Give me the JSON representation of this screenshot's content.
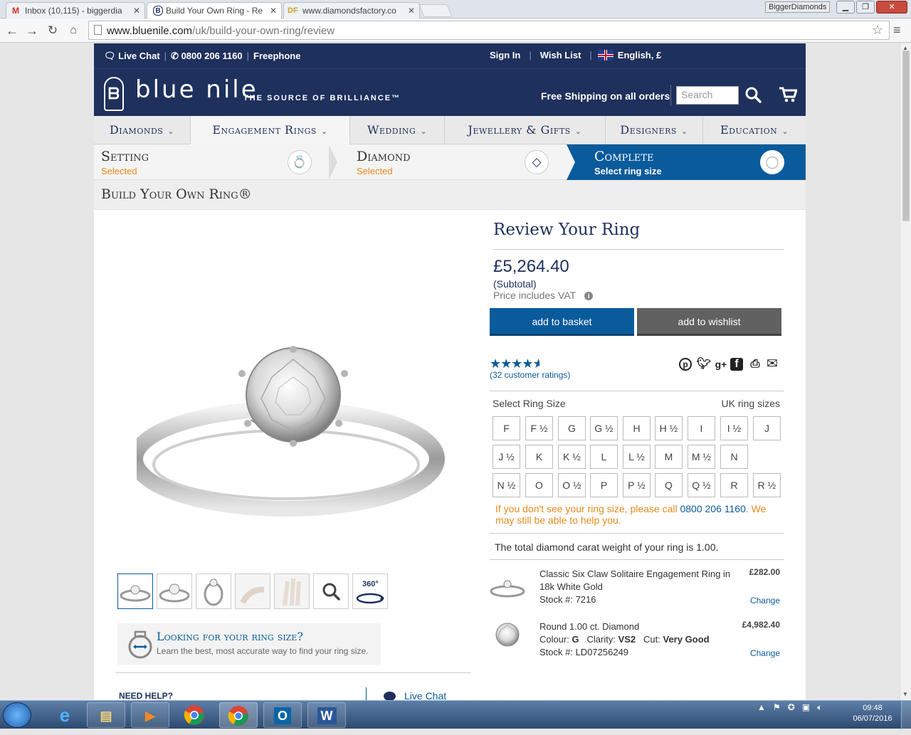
{
  "browser": {
    "tabs": [
      {
        "icon": "M",
        "title": "Inbox (10,115) - biggerdia"
      },
      {
        "icon": "B",
        "title": "Build Your Own Ring - Re"
      },
      {
        "icon": "DF",
        "title": "www.diamondsfactory.co"
      }
    ],
    "user_badge": "BiggerDiamonds",
    "url_host": "www.bluenile.com",
    "url_path": "/uk/build-your-own-ring/review"
  },
  "util": {
    "live_chat": "Live Chat",
    "phone": "0800 206 1160",
    "freephone": "Freephone",
    "sign_in": "Sign In",
    "wish_list": "Wish List",
    "locale": "English, £"
  },
  "header": {
    "logo_text": "blue nile",
    "tagline": "THE SOURCE OF BRILLIANCE™",
    "free_shipping": "Free Shipping on all orders",
    "search_placeholder": "Search"
  },
  "nav": [
    "Diamonds",
    "Engagement Rings",
    "Wedding",
    "Jewellery & Gifts",
    "Designers",
    "Education"
  ],
  "steps": [
    {
      "title": "Setting",
      "sub": "Selected"
    },
    {
      "title": "Diamond",
      "sub": "Selected"
    },
    {
      "title": "Complete",
      "sub": "Select ring size"
    }
  ],
  "page_title": "Build Your Own Ring®",
  "left": {
    "thumb_360": "360°",
    "ringsize_title": "Looking for your ring size?",
    "ringsize_sub": "Learn the best, most accurate way to find your ring size.",
    "need_help": "NEED HELP?",
    "live_chat": "Live Chat"
  },
  "review": {
    "title": "Review Your Ring",
    "price": "£5,264.40",
    "subtotal": "(Subtotal)",
    "vat": "Price includes VAT",
    "add_basket": "add to basket",
    "add_wishlist": "add to wishlist",
    "rating": 4.5,
    "ratings_text": "(32 customer ratings)",
    "select_ring_size": "Select Ring Size",
    "uk_ring_sizes": "UK ring sizes",
    "sizes": [
      [
        "F",
        "F ½",
        "G",
        "G ½",
        "H",
        "H ½",
        "I",
        "I ½",
        "J"
      ],
      [
        "J ½",
        "K",
        "K ½",
        "L",
        "L ½",
        "M",
        "M ½",
        "N"
      ],
      [
        "N ½",
        "O",
        "O ½",
        "P",
        "P ½",
        "Q",
        "Q ½",
        "R",
        "R ½"
      ]
    ],
    "size_note_pre": "If you don't see your ring size, please call",
    "size_note_tel": "0800 206 1160",
    "size_note_post": ". We may still be able to help you.",
    "carat_note": "The total diamond carat weight of your ring is 1.00.",
    "items": [
      {
        "line1": "Classic Six Claw Solitaire Engagement Ring in",
        "line2": "18k White Gold",
        "line3": "Stock #: 7216",
        "price": "£282.00",
        "change": "Change"
      },
      {
        "line1": "Round 1.00 ct. Diamond",
        "colour_label": "Colour:",
        "colour": "G",
        "clarity_label": "Clarity:",
        "clarity": "VS2",
        "cut_label": "Cut:",
        "cut": "Very Good",
        "line3": "Stock #: LD07256249",
        "price": "£4,982.40",
        "change": "Change"
      }
    ]
  },
  "taskbar": {
    "time": "09:48",
    "date": "06/07/2016"
  },
  "colors": {
    "navy": "#1e305c",
    "blue": "#0a5b9c",
    "orange": "#e8891d"
  }
}
